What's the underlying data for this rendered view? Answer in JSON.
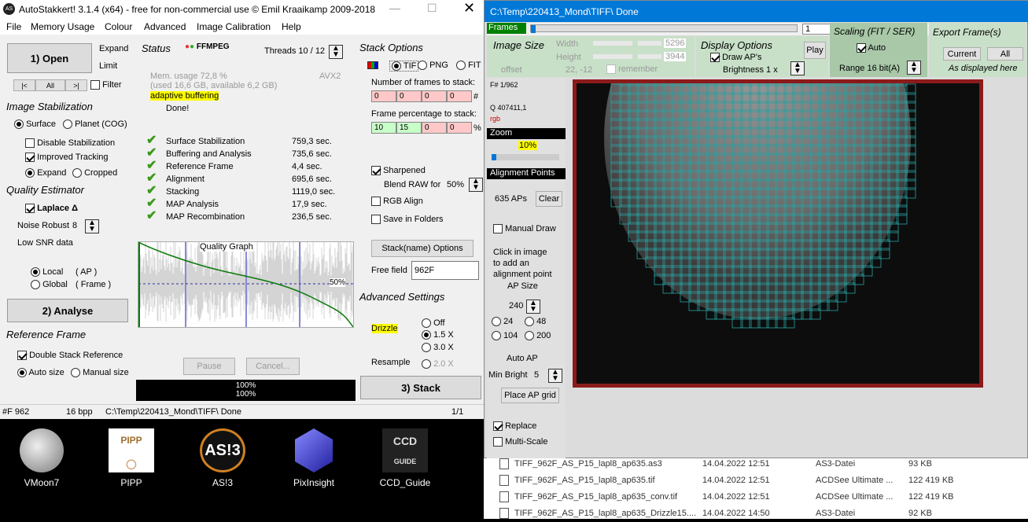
{
  "main_window": {
    "title": "AutoStakkert! 3.1.4 (x64) - free for non-commercial use © Emil Kraaikamp 2009-2018",
    "menu": [
      "File",
      "Memory Usage",
      "Colour",
      "Advanced",
      "Image Calibration",
      "Help"
    ]
  },
  "left": {
    "open": "1) Open",
    "expand": "Expand",
    "limit": "Limit",
    "nav_prev": "|<",
    "nav_all": "All",
    "nav_next": ">|",
    "filter": "Filter",
    "image_stab": "Image Stabilization",
    "surface": "Surface",
    "planet": "Planet (COG)",
    "disable_stab": "Disable Stabilization",
    "improved": "Improved Tracking",
    "expand_opt": "Expand",
    "cropped": "Cropped",
    "quality": "Quality Estimator",
    "laplace": "Laplace Δ",
    "noise": "Noise Robust",
    "noise_val": "8",
    "lowsnr": "Low SNR data",
    "local": "Local",
    "local_ap": "( AP )",
    "global": "Global",
    "global_frame": "( Frame )",
    "analyse": "2) Analyse",
    "ref_frame": "Reference Frame",
    "double_stack": "Double Stack Reference",
    "auto_size": "Auto size",
    "manual_size": "Manual size"
  },
  "status": {
    "title": "Status",
    "ffmpeg": "FFMPEG",
    "threads": "Threads 10 / 12",
    "avx": "AVX2",
    "mem1": "Mem. usage 72,8 %",
    "mem2": "(used 16,6 GB, available 6,2 GB)",
    "adaptive": "adaptive buffering",
    "done": "Done!",
    "tasks": [
      {
        "name": "Surface Stabilization",
        "time": "759,3 sec."
      },
      {
        "name": "Buffering and Analysis",
        "time": "735,6 sec."
      },
      {
        "name": "Reference Frame",
        "time": "4,4 sec."
      },
      {
        "name": "Alignment",
        "time": "695,6 sec."
      },
      {
        "name": "Stacking",
        "time": "1119,0 sec."
      },
      {
        "name": "MAP Analysis",
        "time": "17,9 sec."
      },
      {
        "name": "MAP Recombination",
        "time": "236,5 sec."
      }
    ],
    "graph_title": "Quality Graph",
    "graph_pct": "50%",
    "pause": "Pause",
    "cancel": "Cancel...",
    "prog1": "100%",
    "prog2": "100%"
  },
  "stack": {
    "title": "Stack Options",
    "tif": "TIF",
    "png": "PNG",
    "fit": "FIT",
    "nframes": "Number of frames to stack:",
    "nf": [
      "0",
      "0",
      "0",
      "0"
    ],
    "hash": "#",
    "fpct": "Frame percentage to stack:",
    "fp": [
      "10",
      "15",
      "0",
      "0"
    ],
    "pct": "%",
    "sharpened": "Sharpened",
    "blend": "Blend RAW for",
    "blend_val": "50%",
    "rgb": "RGB Align",
    "folders": "Save in Folders",
    "stackname": "Stack(name) Options",
    "freefield": "Free field",
    "freefield_val": "962F",
    "adv": "Advanced Settings",
    "drizzle": "Drizzle",
    "off": "Off",
    "x15": "1.5 X",
    "x30": "3.0 X",
    "resample": "Resample",
    "x20": "2.0 X",
    "stack_btn": "3) Stack"
  },
  "statusbar": {
    "frame": "#F 962",
    "bpp": "16 bpp",
    "path": "C:\\Temp\\220413_Mond\\TIFF\\  Done",
    "page": "1/1"
  },
  "desktop": [
    {
      "label": "VMoon7"
    },
    {
      "label": "PIPP"
    },
    {
      "label": "AS!3"
    },
    {
      "label": "PixInsight"
    },
    {
      "label": "CCD_Guide"
    }
  ],
  "second_window": {
    "title": "C:\\Temp\\220413_Mond\\TIFF\\  Done",
    "frames": "Frames",
    "frame_val": "1",
    "imgsize": "Image Size",
    "width": "Width",
    "width_val": "5296",
    "height": "Height",
    "height_val": "3944",
    "offset": "offset",
    "offset_val": "22, -12",
    "remember": "remember",
    "display": "Display Options",
    "draw_aps": "Draw AP's",
    "play": "Play",
    "brightness": "Brightness  1 x",
    "scaling": "Scaling (FIT / SER)",
    "auto": "Auto",
    "range": "Range 16 bit(A)",
    "export": "Export Frame(s)",
    "current": "Current",
    "all": "All",
    "as_displayed": "As displayed here",
    "fnum": "F# 1/962",
    "q": "Q  407411,1",
    "rgb": "rgb",
    "zoom": "Zoom",
    "zoom_val": "10%",
    "ap_title": "Alignment Points",
    "aps": "635 APs",
    "clear": "Clear",
    "manual_draw": "Manual Draw",
    "click_hint": [
      "Click in image",
      "to add an",
      "alignment point"
    ],
    "ap_size": "AP Size",
    "ap_size_val": "240",
    "s24": "24",
    "s48": "48",
    "s104": "104",
    "s200": "200",
    "auto_ap": "Auto AP",
    "minbright": "Min Bright",
    "minbright_val": "5",
    "place": "Place AP grid",
    "replace": "Replace",
    "multiscale": "Multi-Scale"
  },
  "files": [
    {
      "name": "TIFF_962F_AS_P15_lapl8_ap635.as3",
      "date": "14.04.2022 12:51",
      "type": "AS3-Datei",
      "size": "93 KB"
    },
    {
      "name": "TIFF_962F_AS_P15_lapl8_ap635.tif",
      "date": "14.04.2022 12:51",
      "type": "ACDSee Ultimate ...",
      "size": "122 419 KB"
    },
    {
      "name": "TIFF_962F_AS_P15_lapl8_ap635_conv.tif",
      "date": "14.04.2022 12:51",
      "type": "ACDSee Ultimate ...",
      "size": "122 419 KB"
    },
    {
      "name": "TIFF_962F_AS_P15_lapl8_ap635_Drizzle15....",
      "date": "14.04.2022 14:50",
      "type": "AS3-Datei",
      "size": "92 KB"
    }
  ]
}
